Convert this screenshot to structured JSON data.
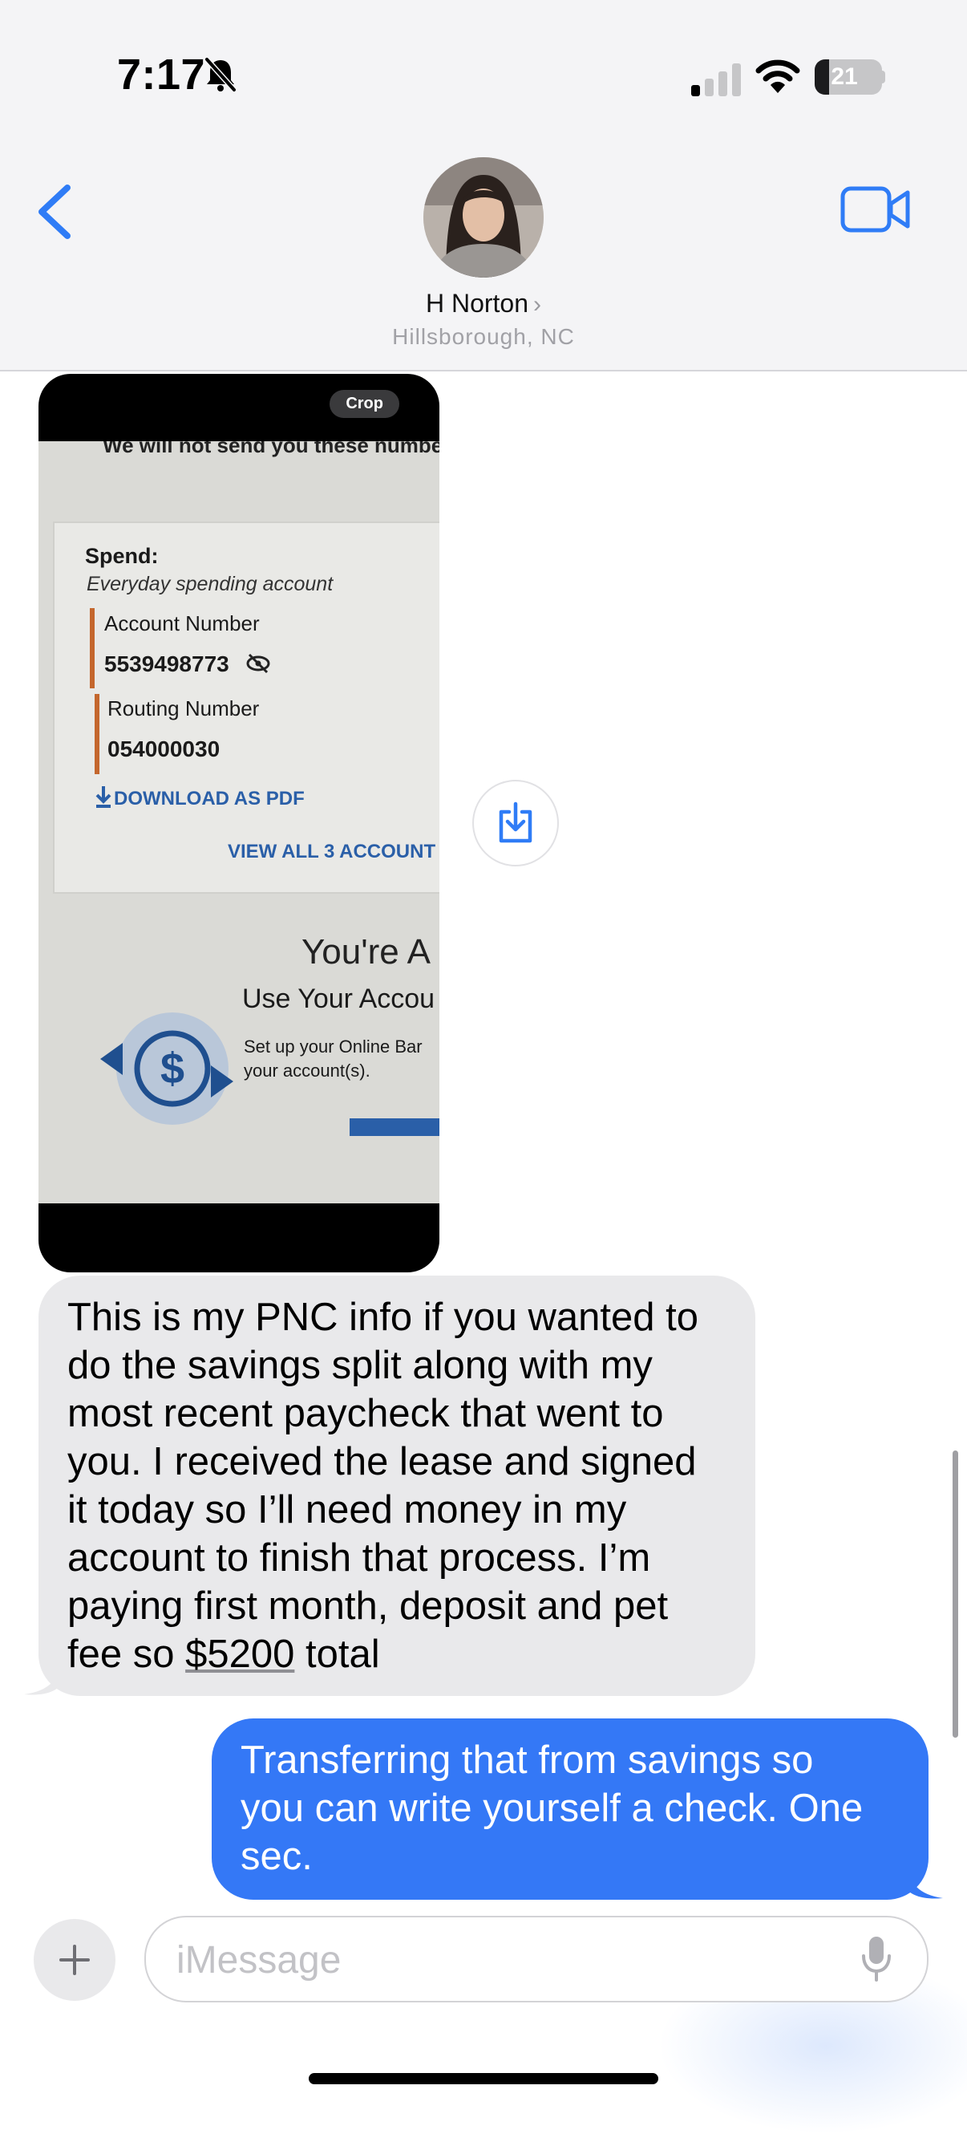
{
  "status_bar": {
    "time": "7:17",
    "battery": "21",
    "battery_level": 0.21,
    "icons": [
      "bell-slash-icon",
      "cellular-signal-icon",
      "wifi-icon",
      "battery-icon"
    ]
  },
  "header": {
    "contact_name": "H Norton",
    "contact_chevron": "›",
    "contact_location": "Hillsborough, NC",
    "icons": [
      "back-chevron-icon",
      "video-camera-icon"
    ]
  },
  "photo_message": {
    "crop_label": "Crop",
    "cut_text": "We will not send you these numbe",
    "spend_label": "Spend:",
    "spend_sub": "Everyday spending account",
    "account_label": "Account Number",
    "account_value": "5539498773",
    "routing_label": "Routing Number",
    "routing_value": "054000030",
    "download_label": "DOWNLOAD AS PDF",
    "view_all_label": "VIEW ALL 3 ACCOUNT",
    "youre_text": "You're A",
    "use_account": "Use Your Accou",
    "setup_line1": "Set up your Online Bar",
    "setup_line2": "your account(s)."
  },
  "messages": [
    {
      "direction": "incoming",
      "text_before": "This is my PNC info if you wanted to\ndo the savings split along with my\nmost recent paycheck that went to\nyou. I received the lease and signed\nit today so I’ll need money in my\naccount to finish that process. I’m\npaying first month, deposit and pet\nfee so ",
      "amount": "$5200",
      "text_after": " total"
    },
    {
      "direction": "outgoing",
      "text": "Transferring that from savings so\nyou can write yourself a check. One\nsec."
    }
  ],
  "compose": {
    "placeholder": "iMessage",
    "plus_label": "+",
    "icons": [
      "plus-icon",
      "microphone-icon"
    ]
  },
  "colors": {
    "imessage_blue": "#3478f6",
    "incoming_gray": "#e9e9eb",
    "ios_blue": "#2f7cf6"
  }
}
